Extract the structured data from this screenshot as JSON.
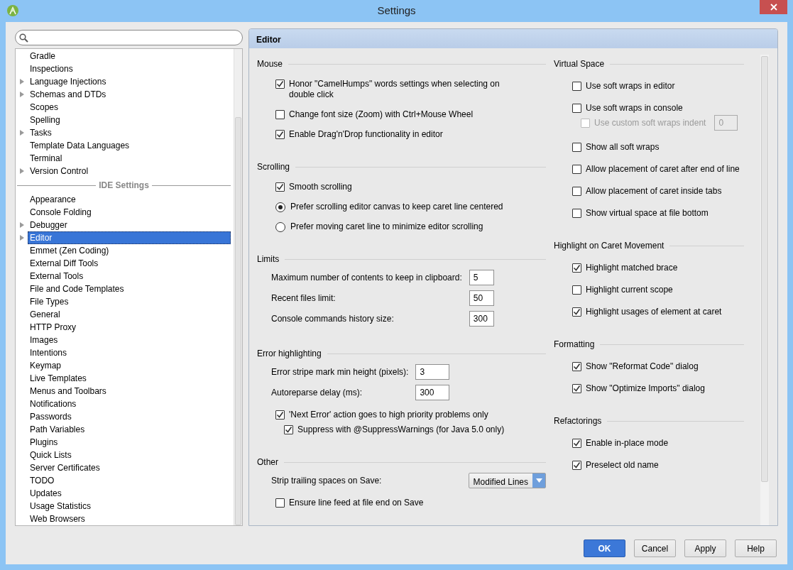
{
  "window": {
    "title": "Settings"
  },
  "sidebar": {
    "items": [
      {
        "label": "Gradle",
        "expandable": false,
        "selected": false
      },
      {
        "label": "Inspections",
        "expandable": false,
        "selected": false
      },
      {
        "label": "Language Injections",
        "expandable": true,
        "selected": false
      },
      {
        "label": "Schemas and DTDs",
        "expandable": true,
        "selected": false
      },
      {
        "label": "Scopes",
        "expandable": false,
        "selected": false
      },
      {
        "label": "Spelling",
        "expandable": false,
        "selected": false
      },
      {
        "label": "Tasks",
        "expandable": true,
        "selected": false
      },
      {
        "label": "Template Data Languages",
        "expandable": false,
        "selected": false
      },
      {
        "label": "Terminal",
        "expandable": false,
        "selected": false
      },
      {
        "label": "Version Control",
        "expandable": true,
        "selected": false
      }
    ],
    "separator": "IDE Settings",
    "ide_items": [
      {
        "label": "Appearance",
        "expandable": false,
        "selected": false
      },
      {
        "label": "Console Folding",
        "expandable": false,
        "selected": false
      },
      {
        "label": "Debugger",
        "expandable": true,
        "selected": false
      },
      {
        "label": "Editor",
        "expandable": true,
        "selected": true
      },
      {
        "label": "Emmet (Zen Coding)",
        "expandable": false,
        "selected": false
      },
      {
        "label": "External Diff Tools",
        "expandable": false,
        "selected": false
      },
      {
        "label": "External Tools",
        "expandable": false,
        "selected": false
      },
      {
        "label": "File and Code Templates",
        "expandable": false,
        "selected": false
      },
      {
        "label": "File Types",
        "expandable": false,
        "selected": false
      },
      {
        "label": "General",
        "expandable": false,
        "selected": false
      },
      {
        "label": "HTTP Proxy",
        "expandable": false,
        "selected": false
      },
      {
        "label": "Images",
        "expandable": false,
        "selected": false
      },
      {
        "label": "Intentions",
        "expandable": false,
        "selected": false
      },
      {
        "label": "Keymap",
        "expandable": false,
        "selected": false
      },
      {
        "label": "Live Templates",
        "expandable": false,
        "selected": false
      },
      {
        "label": "Menus and Toolbars",
        "expandable": false,
        "selected": false
      },
      {
        "label": "Notifications",
        "expandable": false,
        "selected": false
      },
      {
        "label": "Passwords",
        "expandable": false,
        "selected": false
      },
      {
        "label": "Path Variables",
        "expandable": false,
        "selected": false
      },
      {
        "label": "Plugins",
        "expandable": false,
        "selected": false
      },
      {
        "label": "Quick Lists",
        "expandable": false,
        "selected": false
      },
      {
        "label": "Server Certificates",
        "expandable": false,
        "selected": false
      },
      {
        "label": "TODO",
        "expandable": false,
        "selected": false
      },
      {
        "label": "Updates",
        "expandable": false,
        "selected": false
      },
      {
        "label": "Usage Statistics",
        "expandable": false,
        "selected": false
      },
      {
        "label": "Web Browsers",
        "expandable": false,
        "selected": false
      }
    ]
  },
  "panel": {
    "title": "Editor",
    "columns": [
      [
        {
          "title": "Mouse",
          "items": [
            {
              "kind": "checkbox",
              "label": "Honor \"CamelHumps\" words settings when selecting on double click",
              "checked": true,
              "disabled": false
            },
            {
              "kind": "checkbox",
              "label": "Change font size (Zoom) with Ctrl+Mouse Wheel",
              "checked": false,
              "disabled": false
            },
            {
              "kind": "checkbox",
              "label": "Enable Drag'n'Drop functionality in editor",
              "checked": true,
              "disabled": false
            }
          ]
        },
        {
          "title": "Scrolling",
          "items": [
            {
              "kind": "checkbox",
              "label": "Smooth scrolling",
              "checked": true,
              "disabled": false
            },
            {
              "kind": "radio",
              "label": "Prefer scrolling editor canvas to keep caret line centered",
              "selected": true
            },
            {
              "kind": "radio",
              "label": "Prefer moving caret line to minimize editor scrolling",
              "selected": false
            }
          ]
        },
        {
          "title": "Limits",
          "items": [
            {
              "kind": "number",
              "label": "Maximum number of contents to keep in clipboard:",
              "value": "5"
            },
            {
              "kind": "number",
              "label": "Recent files limit:",
              "value": "50"
            },
            {
              "kind": "number",
              "label": "Console commands history size:",
              "value": "300"
            }
          ]
        },
        {
          "title": "Error highlighting",
          "items": [
            {
              "kind": "number",
              "label": "Error stripe mark min height (pixels):",
              "value": "3"
            },
            {
              "kind": "number",
              "label": "Autoreparse delay (ms):",
              "value": "300"
            },
            {
              "kind": "checkbox",
              "label": "'Next Error' action goes to high priority problems only",
              "checked": true,
              "disabled": false,
              "children": [
                {
                  "kind": "checkbox",
                  "label": "Suppress with @SuppressWarnings (for Java 5.0 only)",
                  "checked": true,
                  "disabled": false
                }
              ]
            }
          ]
        },
        {
          "title": "Other",
          "items": [
            {
              "kind": "dropdown",
              "label": "Strip trailing spaces on Save:",
              "value": "Modified Lines"
            },
            {
              "kind": "checkbox",
              "label": "Ensure line feed at file end on Save",
              "checked": false,
              "disabled": false
            }
          ]
        }
      ],
      [
        {
          "title": "Virtual Space",
          "items": [
            {
              "kind": "checkbox",
              "label": "Use soft wraps in editor",
              "checked": false,
              "disabled": false
            },
            {
              "kind": "checkbox",
              "label": "Use soft wraps in console",
              "checked": false,
              "disabled": false,
              "children": [
                {
                  "kind": "checkbox",
                  "label": "Use custom soft wraps indent",
                  "checked": false,
                  "disabled": true,
                  "value": "0"
                }
              ]
            },
            {
              "kind": "checkbox",
              "label": "Show all soft wraps",
              "checked": false,
              "disabled": false
            },
            {
              "kind": "checkbox",
              "label": "Allow placement of caret after end of line",
              "checked": false,
              "disabled": false
            },
            {
              "kind": "checkbox",
              "label": "Allow placement of caret inside tabs",
              "checked": false,
              "disabled": false
            },
            {
              "kind": "checkbox",
              "label": "Show virtual space at file bottom",
              "checked": false,
              "disabled": false
            }
          ]
        },
        {
          "title": "Highlight on Caret Movement",
          "items": [
            {
              "kind": "checkbox",
              "label": "Highlight matched brace",
              "checked": true,
              "disabled": false
            },
            {
              "kind": "checkbox",
              "label": "Highlight current scope",
              "checked": false,
              "disabled": false
            },
            {
              "kind": "checkbox",
              "label": "Highlight usages of element at caret",
              "checked": true,
              "disabled": false
            }
          ]
        },
        {
          "title": "Formatting",
          "items": [
            {
              "kind": "checkbox",
              "label": "Show \"Reformat Code\" dialog",
              "checked": true,
              "disabled": false
            },
            {
              "kind": "checkbox",
              "label": "Show \"Optimize Imports\" dialog",
              "checked": true,
              "disabled": false
            }
          ]
        },
        {
          "title": "Refactorings",
          "items": [
            {
              "kind": "checkbox",
              "label": "Enable in-place mode",
              "checked": true,
              "disabled": false
            },
            {
              "kind": "checkbox",
              "label": "Preselect old name",
              "checked": true,
              "disabled": false
            }
          ]
        }
      ]
    ]
  },
  "buttons": [
    {
      "label": "OK",
      "primary": true
    },
    {
      "label": "Cancel",
      "primary": false
    },
    {
      "label": "Apply",
      "primary": false
    },
    {
      "label": "Help",
      "primary": false
    }
  ]
}
